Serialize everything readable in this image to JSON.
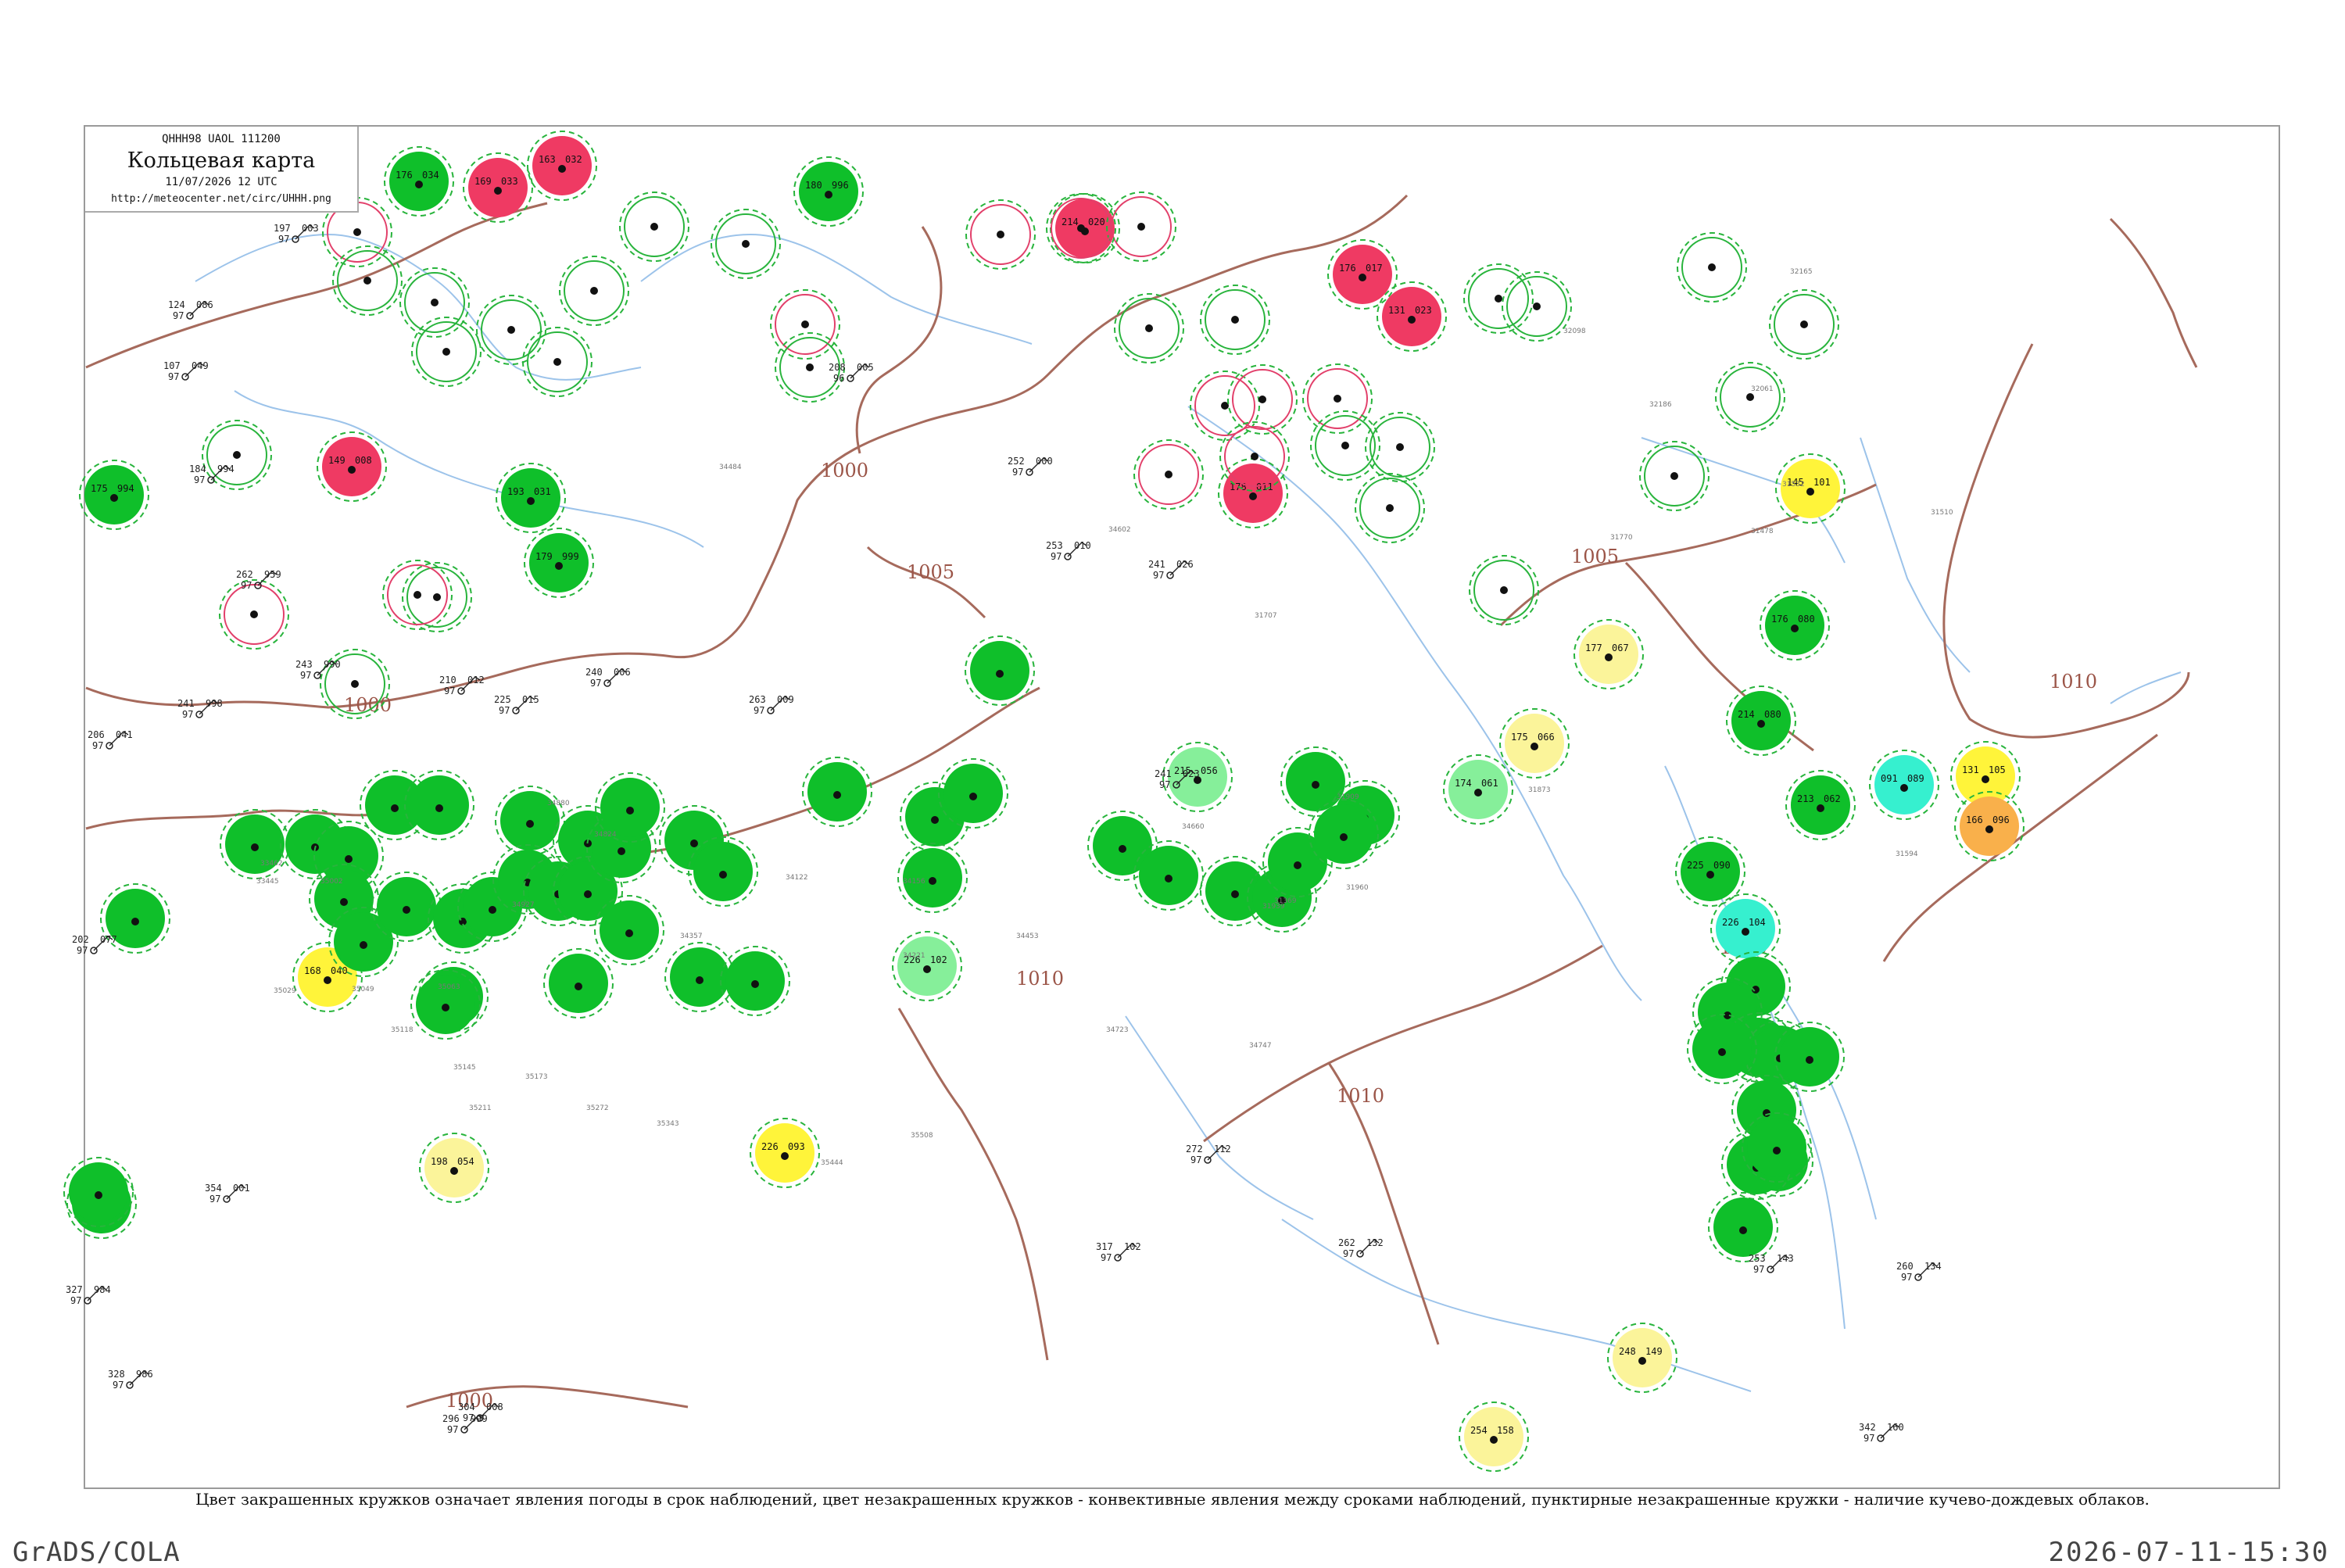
{
  "header": {
    "code": "QHHH98  UAOL  111200",
    "title": "Кольцевая карта",
    "datetime": "11/07/2026 12 UTC",
    "url": "http://meteocenter.net/circ/UHHH.png"
  },
  "caption": "Цвет закрашенных кружков означает явления погоды в срок наблюдений, цвет незакрашенных кружков - конвективные явления между сроками наблюдений, пунктирные незакрашенные кружки - наличие кучево-дождевых облаков.",
  "footer": {
    "software": "GrADS/COLA",
    "timestamp": "2026-07-11-15:30"
  },
  "colors": {
    "filled_green": "#0fbf2a",
    "filled_red": "#ef3a63",
    "filled_yellow": "#fff43a",
    "filled_light_yellow": "#fbf49a",
    "filled_light_green": "#86ef9a",
    "filled_cyan": "#36f0cf",
    "filled_orange": "#f9b04b",
    "isobar": "#a66a5c",
    "river": "#9cc3ea",
    "ring_green_dashed": "#28b43c",
    "ring_red": "#e23f6a"
  },
  "isobar_labels": [
    "1000",
    "1005",
    "1010",
    "1000",
    "1005",
    "1010",
    "1010",
    "1010",
    "1000"
  ],
  "rings": [
    {
      "type": "filled",
      "color": "green",
      "label_left": "176",
      "label_right": "034"
    },
    {
      "type": "filled",
      "color": "red",
      "label_left": "169",
      "label_right": "033"
    },
    {
      "type": "filled",
      "color": "red",
      "label_left": "163",
      "label_right": "032"
    },
    {
      "type": "filled",
      "color": "green",
      "label_left": "193",
      "label_right": "031"
    },
    {
      "type": "filled",
      "color": "red",
      "label_left": "214",
      "label_right": "020"
    },
    {
      "type": "filled",
      "color": "red",
      "label_left": "176",
      "label_right": "017"
    },
    {
      "type": "filled",
      "color": "red",
      "label_left": "131",
      "label_right": "023"
    },
    {
      "type": "filled",
      "color": "red",
      "label_left": "149",
      "label_right": "008"
    },
    {
      "type": "filled",
      "color": "red",
      "label_left": "178",
      "label_right": "011"
    },
    {
      "type": "filled",
      "color": "green",
      "label_left": "175",
      "label_right": "994"
    },
    {
      "type": "filled",
      "color": "green",
      "label_left": "179",
      "label_right": "999"
    },
    {
      "type": "filled",
      "color": "green",
      "label_left": "180",
      "label_right": "996"
    },
    {
      "type": "filled",
      "color": "yellow",
      "label_left": "145",
      "label_right": "101"
    },
    {
      "type": "filled",
      "color": "green",
      "label_left": "176",
      "label_right": "080"
    },
    {
      "type": "filled",
      "color": "light_yellow",
      "label_left": "177",
      "label_right": "067"
    },
    {
      "type": "filled",
      "color": "light_yellow",
      "label_left": "175",
      "label_right": "066"
    },
    {
      "type": "filled",
      "color": "light_green",
      "label_left": "174",
      "label_right": "061"
    },
    {
      "type": "filled",
      "color": "green",
      "label_left": "214",
      "label_right": "080"
    },
    {
      "type": "filled",
      "color": "green",
      "label_left": "213",
      "label_right": "062"
    },
    {
      "type": "filled",
      "color": "cyan",
      "label_left": "091",
      "label_right": "089"
    },
    {
      "type": "filled",
      "color": "yellow",
      "label_left": "131",
      "label_right": "105"
    },
    {
      "type": "filled",
      "color": "orange",
      "label_left": "166",
      "label_right": "096"
    },
    {
      "type": "filled",
      "color": "green",
      "label_left": "225",
      "label_right": "090"
    },
    {
      "type": "filled",
      "color": "cyan",
      "label_left": "226",
      "label_right": "104"
    },
    {
      "type": "filled",
      "color": "yellow",
      "label_left": "226",
      "label_right": "093"
    },
    {
      "type": "filled",
      "color": "yellow",
      "label_left": "168",
      "label_right": "040"
    },
    {
      "type": "filled",
      "color": "light_yellow",
      "label_left": "198",
      "label_right": "054"
    },
    {
      "type": "filled",
      "color": "light_yellow",
      "label_left": "248",
      "label_right": "149"
    },
    {
      "type": "filled",
      "color": "light_yellow",
      "label_left": "254",
      "label_right": "158"
    },
    {
      "type": "filled",
      "color": "light_green",
      "label_left": "226",
      "label_right": "102"
    },
    {
      "type": "filled",
      "color": "light_green",
      "label_left": "215",
      "label_right": "056"
    }
  ],
  "stations": [
    {
      "pressure": "086",
      "temp": "124",
      "id": "97"
    },
    {
      "pressure": "049",
      "temp": "107",
      "id": "97"
    },
    {
      "pressure": "994",
      "temp": "184",
      "id": "97"
    },
    {
      "pressure": "959",
      "temp": "262",
      "id": "97"
    },
    {
      "pressure": "990",
      "temp": "243",
      "id": "97"
    },
    {
      "pressure": "998",
      "temp": "241",
      "id": "97"
    },
    {
      "pressure": "041",
      "temp": "206",
      "id": "97"
    },
    {
      "pressure": "077",
      "temp": "202",
      "id": "97"
    },
    {
      "pressure": "003",
      "temp": "197",
      "id": "97"
    },
    {
      "pressure": "005",
      "temp": "208",
      "id": "96"
    },
    {
      "pressure": "000",
      "temp": "252",
      "id": "97"
    },
    {
      "pressure": "010",
      "temp": "253",
      "id": "97"
    },
    {
      "pressure": "026",
      "temp": "241",
      "id": "97"
    },
    {
      "pressure": "023",
      "temp": "241",
      "id": "97"
    },
    {
      "pressure": "012",
      "temp": "210",
      "id": "97"
    },
    {
      "pressure": "015",
      "temp": "225",
      "id": "97"
    },
    {
      "pressure": "006",
      "temp": "240",
      "id": "97"
    },
    {
      "pressure": "009",
      "temp": "263",
      "id": "97"
    },
    {
      "pressure": "112",
      "temp": "272",
      "id": "97"
    },
    {
      "pressure": "102",
      "temp": "317",
      "id": "97"
    },
    {
      "pressure": "132",
      "temp": "262",
      "id": "97"
    },
    {
      "pressure": "143",
      "temp": "253",
      "id": "97"
    },
    {
      "pressure": "160",
      "temp": "342",
      "id": "97"
    },
    {
      "pressure": "134",
      "temp": "260",
      "id": "97"
    },
    {
      "pressure": "001",
      "temp": "354",
      "id": "97"
    },
    {
      "pressure": "008",
      "temp": "304",
      "id": "97"
    },
    {
      "pressure": "999",
      "temp": "296",
      "id": "97"
    },
    {
      "pressure": "984",
      "temp": "327",
      "id": "97"
    },
    {
      "pressure": "986",
      "temp": "328",
      "id": "97"
    }
  ],
  "station_ids": [
    "31369",
    "31478",
    "31510",
    "31532",
    "31594",
    "31707",
    "31770",
    "31873",
    "31909",
    "31939",
    "31960",
    "32061",
    "32098",
    "32165",
    "32186",
    "33445",
    "33462",
    "34122",
    "34156",
    "34221",
    "34357",
    "34453",
    "34484",
    "34602",
    "34660",
    "34723",
    "34747",
    "34824",
    "34880",
    "34927",
    "35002",
    "35029",
    "35049",
    "35063",
    "35118",
    "35145",
    "35173",
    "35211",
    "35272",
    "35343",
    "35444",
    "35508"
  ]
}
